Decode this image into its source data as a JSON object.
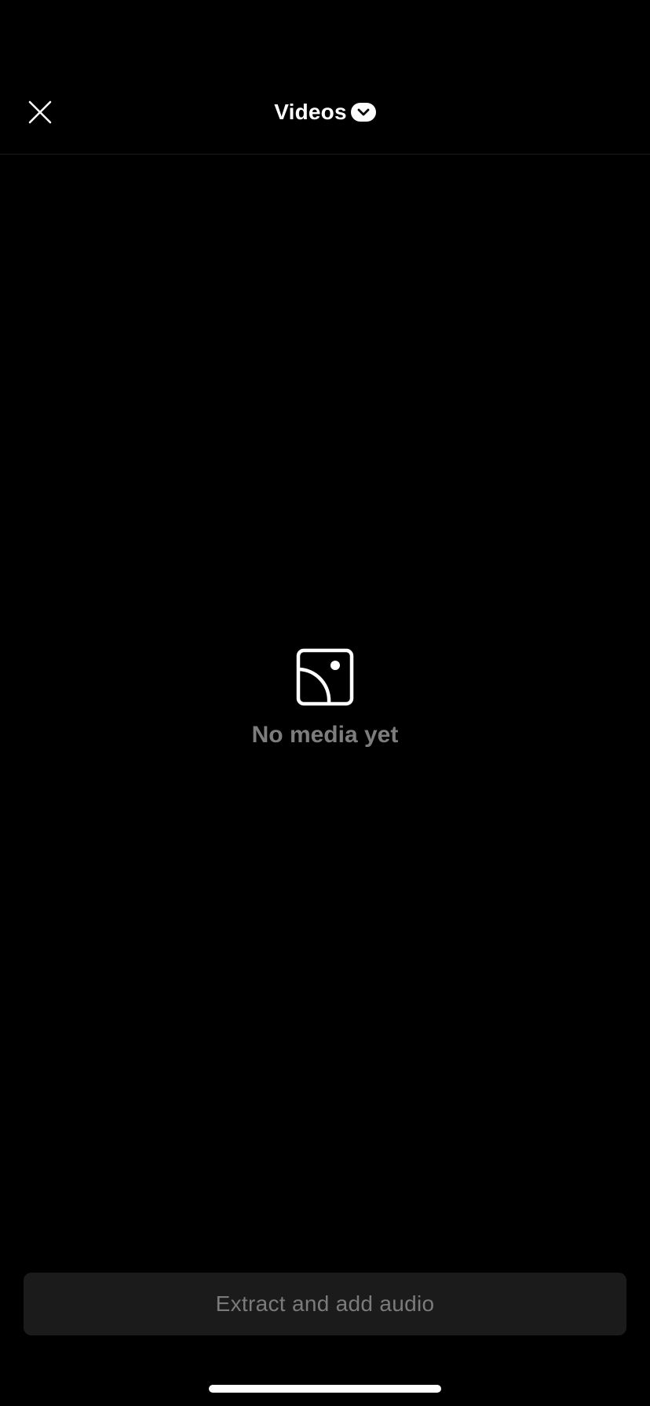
{
  "header": {
    "title": "Videos",
    "close_icon": "close-icon",
    "dropdown_icon": "chevron-down-icon"
  },
  "empty_state": {
    "icon": "image-placeholder-icon",
    "message": "No media yet"
  },
  "footer": {
    "extract_button_label": "Extract and add audio"
  },
  "colors": {
    "background": "#000000",
    "header_divider": "#1c1c1c",
    "title": "#ffffff",
    "empty_text": "#7d7d7d",
    "button_bg": "#1b1b1b",
    "button_text": "#7b7b7b",
    "home_indicator": "#ffffff"
  }
}
